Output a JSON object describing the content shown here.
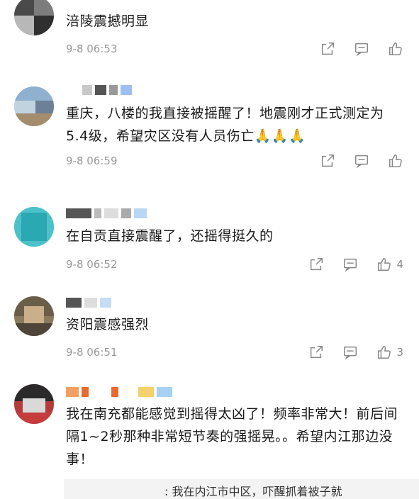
{
  "comments": [
    {
      "text": "涪陵震撼明显",
      "time": "9-8 06:53",
      "likes": ""
    },
    {
      "text": "重庆，八楼的我直接被摇醒了！地震刚才正式测定为5.4级，希望灾区没有人员伤亡🙏🙏🙏",
      "time": "9-8 06:59",
      "likes": ""
    },
    {
      "text": "在自贡直接震醒了，还摇得挺久的",
      "time": "9-8 06:52",
      "likes": "4"
    },
    {
      "text": "资阳震感强烈",
      "time": "9-8 06:51",
      "likes": "3"
    },
    {
      "text": "我在南充都能感觉到摇得太凶了！频率非常大！前后间隔1~2秒那种非常短节奏的强摇晃。。希望内江那边没事！",
      "time": "",
      "likes": ""
    }
  ],
  "reply_preview": ": 我在内江市中区，吓醒抓着被子就",
  "icons": {
    "share": "share-icon",
    "comment": "comment-icon",
    "like": "thumbs-up-icon"
  },
  "colors": {
    "text": "#1a1a1a",
    "time": "#9a9a9a",
    "icon": "#888888"
  }
}
